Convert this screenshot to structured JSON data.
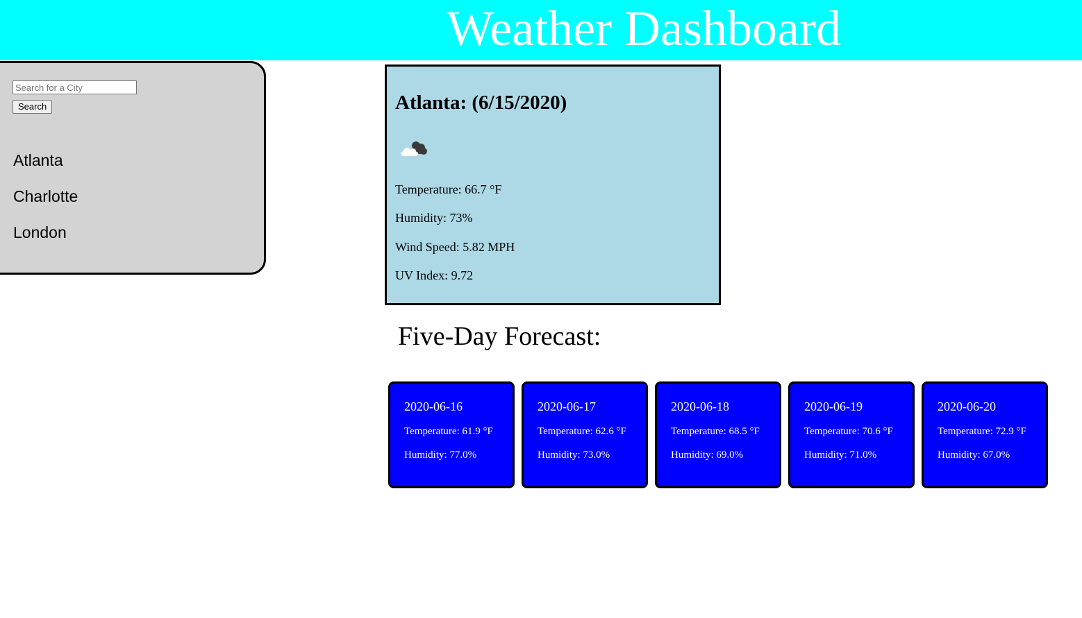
{
  "header": {
    "title": "Weather Dashboard",
    "background": "#00ffff"
  },
  "sidebar": {
    "search_placeholder": "Search for a City",
    "search_value": "",
    "search_button_label": "Search",
    "cities": [
      "Atlanta",
      "Charlotte",
      "London"
    ],
    "background": "#d3d3d3"
  },
  "current": {
    "title": "Atlanta: (6/15/2020)",
    "icon": "cloudy-icon",
    "temperature": "Temperature: 66.7 °F",
    "humidity": "Humidity: 73%",
    "wind_speed": "Wind Speed: 5.82 MPH",
    "uv_index": "UV Index: 9.72",
    "background": "#add8e6"
  },
  "forecast": {
    "heading": "Five-Day Forecast:",
    "card_color": "#0000ff",
    "days": [
      {
        "date": "2020-06-16",
        "temperature": "Temperature: 61.9 °F",
        "humidity": "Humidity: 77.0%"
      },
      {
        "date": "2020-06-17",
        "temperature": "Temperature: 62.6 °F",
        "humidity": "Humidity: 73.0%"
      },
      {
        "date": "2020-06-18",
        "temperature": "Temperature: 68.5 °F",
        "humidity": "Humidity: 69.0%"
      },
      {
        "date": "2020-06-19",
        "temperature": "Temperature: 70.6 °F",
        "humidity": "Humidity: 71.0%"
      },
      {
        "date": "2020-06-20",
        "temperature": "Temperature: 72.9 °F",
        "humidity": "Humidity: 67.0%"
      }
    ]
  }
}
